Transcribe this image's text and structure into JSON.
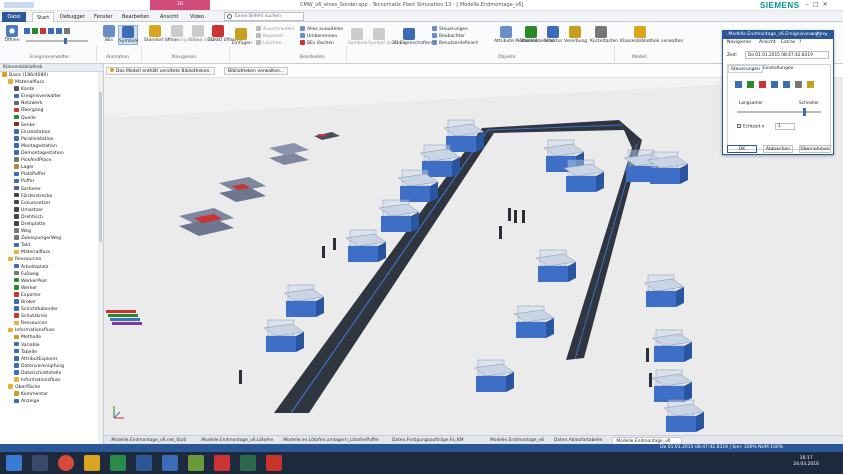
{
  "window": {
    "title": "CMW_v6_eines_Sonder.spp - Tecnomatix Plant Simulation 13 - [.Modelle.Endmontage_v6]",
    "context_tab": "3D",
    "brand": "SIEMENS"
  },
  "tabs": [
    "Datei",
    "Start",
    "Debugger",
    "Fenster",
    "Bearbeiten",
    "Ansicht",
    "Video"
  ],
  "search": {
    "placeholder": "Einen Befehl suchen"
  },
  "ribbon": {
    "open": "Öffnen",
    "eventcontroller": "Ereignisverwalter",
    "bes": "BEs",
    "symbols": "Symbole",
    "animation": "Animation",
    "navigate": "Navigieren",
    "std_open": "Standort öffnen",
    "origin_open": "Ursprung öffnen",
    "class_open": "Klasse öffnen",
    "open_2d3d": "2D/3D öffnen",
    "insert": "Einfügen",
    "cut": "Ausschneiden",
    "copy": "Kopieren",
    "delete": "Löschen",
    "select_all": "Alles auswählen",
    "rename": "Umbenennen",
    "delete_bes": "BEs löschen",
    "edit": "Bearbeiten",
    "symbols2": "Symbole",
    "show_symbols": "Symbol anzeigen",
    "props_3d": "3D-Eigenschaften",
    "controls": "Steuerungen",
    "observer": "Beobachter",
    "user_defined": "Benutzerdefiniert",
    "objects": "Objekte",
    "attr_methods": "Attribute Methoden",
    "statistics": "Statistikbericht",
    "structure": "Struktur",
    "inheritance": "Vererbung",
    "shortcuts": "Kürzeltasten",
    "class_library": "Klassenbibliothek verwalten",
    "model": "Modell"
  },
  "infobar": {
    "message": "Das Modell enthält veraltete Bibliotheken.",
    "button": "Bibliotheken verwalten..."
  },
  "library": {
    "title": "Klassenbibliothek",
    "items": [
      {
        "l": "Basis (186/4080)",
        "d": 0,
        "c": "#d9a520"
      },
      {
        "l": "Materialfluss",
        "d": 1,
        "c": "#e3b23c"
      },
      {
        "l": "Kante",
        "d": 2,
        "c": "#555"
      },
      {
        "l": "Ereignisverwalter",
        "d": 2,
        "c": "#3a6db5"
      },
      {
        "l": "Netzwerk",
        "d": 2,
        "c": "#666"
      },
      {
        "l": "Übergang",
        "d": 2,
        "c": "#c33"
      },
      {
        "l": "Quelle",
        "d": 2,
        "c": "#2a8a2a"
      },
      {
        "l": "Senke",
        "d": 2,
        "c": "#8a2a2a"
      },
      {
        "l": "Einzelstation",
        "d": 2,
        "c": "#3a6db5"
      },
      {
        "l": "Parallelstation",
        "d": 2,
        "c": "#3a6db5"
      },
      {
        "l": "Montagestation",
        "d": 2,
        "c": "#3a6db5"
      },
      {
        "l": "Demontagestation",
        "d": 2,
        "c": "#3a6db5"
      },
      {
        "l": "PickAndPlace",
        "d": 2,
        "c": "#777"
      },
      {
        "l": "Lager",
        "d": 2,
        "c": "#b58a3a"
      },
      {
        "l": "PlatzPuffer",
        "d": 2,
        "c": "#3a6db5"
      },
      {
        "l": "Puffer",
        "d": 2,
        "c": "#3a6db5"
      },
      {
        "l": "Sortierer",
        "d": 2,
        "c": "#5a5a9a"
      },
      {
        "l": "Förderstrecke",
        "d": 2,
        "c": "#444"
      },
      {
        "l": "Eckumsetzer",
        "d": 2,
        "c": "#444"
      },
      {
        "l": "Umsetzer",
        "d": 2,
        "c": "#444"
      },
      {
        "l": "Drehtisch",
        "d": 2,
        "c": "#444"
      },
      {
        "l": "Drehplatte",
        "d": 2,
        "c": "#444"
      },
      {
        "l": "Weg",
        "d": 2,
        "c": "#777"
      },
      {
        "l": "ZweispurigerWeg",
        "d": 2,
        "c": "#777"
      },
      {
        "l": "Takt",
        "d": 2,
        "c": "#3a6db5"
      },
      {
        "l": "Materialfluss",
        "d": 2,
        "c": "#e3b23c"
      },
      {
        "l": "Ressourcen",
        "d": 1,
        "c": "#e3b23c"
      },
      {
        "l": "Arbeitsplatz",
        "d": 2,
        "c": "#3a6db5"
      },
      {
        "l": "Fußweg",
        "d": 2,
        "c": "#777"
      },
      {
        "l": "WerkerPool",
        "d": 2,
        "c": "#2a8a2a"
      },
      {
        "l": "Werker",
        "d": 2,
        "c": "#2a8a2a"
      },
      {
        "l": "Exporter",
        "d": 2,
        "c": "#c33"
      },
      {
        "l": "Broker",
        "d": 2,
        "c": "#3a6db5"
      },
      {
        "l": "Schichtkalender",
        "d": 2,
        "c": "#3a6db5"
      },
      {
        "l": "Schutzkreis",
        "d": 2,
        "c": "#c33"
      },
      {
        "l": "Ressourcen",
        "d": 2,
        "c": "#e3b23c"
      },
      {
        "l": "Informationsfluss",
        "d": 1,
        "c": "#e3b23c"
      },
      {
        "l": "Methode",
        "d": 2,
        "c": "#c8a020"
      },
      {
        "l": "Variable",
        "d": 2,
        "c": "#3a6db5"
      },
      {
        "l": "Tabelle",
        "d": 2,
        "c": "#3a6db5"
      },
      {
        "l": "AttributExplorer",
        "d": 2,
        "c": "#3a6db5"
      },
      {
        "l": "Datenverknüpfung",
        "d": 2,
        "c": "#3a6db5"
      },
      {
        "l": "Dateischnittstelle",
        "d": 2,
        "c": "#3a6db5"
      },
      {
        "l": "Informationsfluss",
        "d": 2,
        "c": "#e3b23c"
      },
      {
        "l": "Oberfläche",
        "d": 1,
        "c": "#e3b23c"
      },
      {
        "l": "Kommentar",
        "d": 2,
        "c": "#c8a020"
      },
      {
        "l": "Anzeige",
        "d": 2,
        "c": "#3a6db5"
      }
    ]
  },
  "controller": {
    "title": ".Modelle.Endmontage_v6.Ereignisverwalter",
    "menu": [
      "Navigieren",
      "Ansicht",
      "Extras",
      "?"
    ],
    "time_label": "Zeit:",
    "time": "Do 01.01.2015 08:47:42.8319",
    "tabs": [
      "Steuerungen",
      "Einstellungen"
    ],
    "slower": "Langsamer",
    "faster": "Schneller",
    "realtime": "Echtzeit x",
    "realtime_value": "1",
    "ok": "OK",
    "cancel": "Abbrechen",
    "apply": "Übernehmen"
  },
  "doctabs": [
    ".Modelle.Endmontage_v6.net_Stati",
    ".Modelle.Endmontage_v6.Lötofen",
    ".Modelle.en.Lötofen.umlagern_LötofenPuffer",
    "Daten.Fertigungsaufträge.Fa_KM",
    "Modelle.Endmontage_v6",
    "Daten.Ablaufartabelle",
    ".Modelle.Endmontage_v6"
  ],
  "status": {
    "right": "Do 01.01.2015 08:47:42.8319   |   Sim: 100%   NUM   100%"
  },
  "clock": {
    "time": "16:17",
    "date": "24.03.2016"
  },
  "colors": {
    "accent": "#2b5797",
    "brand": "#009999",
    "station": "#3d6fc6",
    "conveyor": "#333a44"
  }
}
